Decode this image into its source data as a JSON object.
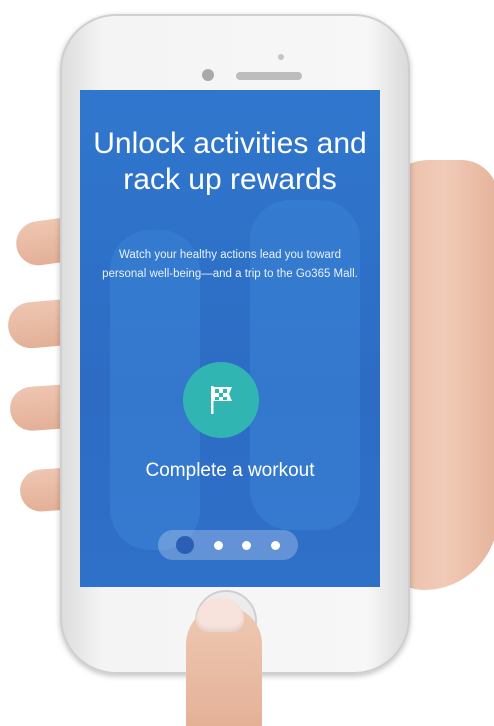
{
  "screen": {
    "headline": "Unlock activities and rack up rewards",
    "subtext": "Watch your healthy actions lead you toward personal well-being—and a trip to the Go365 Mall.",
    "activity_label": "Complete a workout",
    "activity_icon": "checkered-flag-icon",
    "colors": {
      "background": "#2f73c9",
      "icon_circle": "#31b5b2",
      "text": "#ffffff"
    },
    "pager": {
      "total": 4,
      "active_index": 0
    }
  }
}
